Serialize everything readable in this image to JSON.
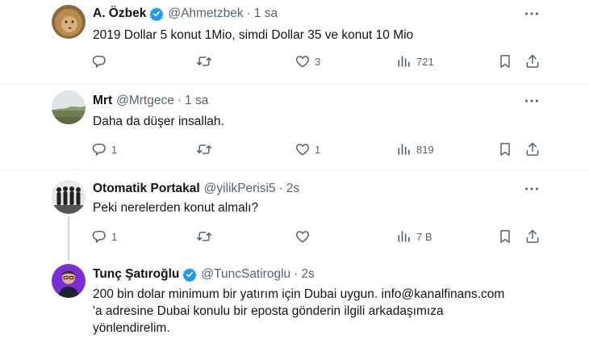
{
  "tweets": [
    {
      "name": "A. Özbek",
      "verified": true,
      "handle": "@Ahmetzbek",
      "time": "1 sa",
      "text": [
        "2019 Dollar 5 konut 1Mio, simdi Dollar 35 ve konut 10 Mio"
      ],
      "replies": "",
      "retweets": "",
      "likes": "3",
      "views": "721"
    },
    {
      "name": "Mrt",
      "verified": false,
      "handle": "@Mrtgece",
      "time": "1 sa",
      "text": [
        "Daha da düşer insallah."
      ],
      "replies": "1",
      "retweets": "",
      "likes": "1",
      "views": "819"
    },
    {
      "name": "Otomatik Portakal",
      "verified": false,
      "handle": "@yilikPerisi5",
      "time": "2s",
      "text": [
        "Peki nerelerden konut almalı?"
      ],
      "replies": "1",
      "retweets": "",
      "likes": "",
      "views": "7 B"
    },
    {
      "name": "Tunç Şatıroğlu",
      "verified": true,
      "handle": "@TuncSatiroglu",
      "time": "2s",
      "text": [
        "200 bin dolar minimum bir yatırım için Dubai uygun. info@kanalfinans.com",
        "'a adresine Dubai konulu bir eposta gönderin ilgili arkadaşımıza",
        "yönlendirelim."
      ]
    }
  ],
  "separator": "·",
  "icons": {
    "more": "more-horizontal-icon",
    "reply": "reply-icon",
    "retweet": "retweet-icon",
    "like": "heart-icon",
    "views": "views-bar-chart-icon",
    "bookmark": "bookmark-icon",
    "share": "share-icon",
    "verified": "verified-badge-icon"
  },
  "colors": {
    "text": "#0f1419",
    "secondary": "#536471",
    "verified": "#1d9bf0",
    "divider": "#eff3f4",
    "thread_line": "#cfd9de"
  }
}
